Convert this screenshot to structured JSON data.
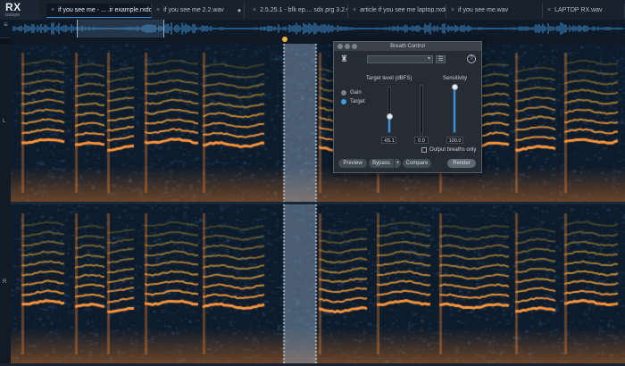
{
  "app": {
    "logo": "RX",
    "logo_sub": "izotope"
  },
  "tabs": [
    {
      "label": "if you see me - ... .ir example.rxdoc",
      "active": true,
      "indicator": ""
    },
    {
      "label": "if you see me 2.2.wav",
      "active": false,
      "indicator": "◆"
    },
    {
      "label": "2.5.25.1 - bfk ep.... sdx prg 3.2.wav",
      "active": false,
      "indicator": ""
    },
    {
      "label": "article if you see me laptop.rxdoc",
      "active": false,
      "indicator": ""
    },
    {
      "label": "if you see me.wav",
      "active": false,
      "indicator": ""
    },
    {
      "label": "LAPTOP RX.wav",
      "active": false,
      "indicator": ""
    }
  ],
  "channels": {
    "left": "L",
    "right": "R"
  },
  "dialog": {
    "title": "Breath Control",
    "target_level_label": "Target level (dBFS)",
    "sensitivity_label": "Sensitivity",
    "gain_label": "Gain",
    "target_label": "Target",
    "mode_selected": "Target",
    "target_value": "-65.1",
    "gain_value": "0.0",
    "sensitivity_value": "100.0",
    "target_slider_level": 0.35,
    "gain_meter_level": 0.0,
    "sensitivity_slider_level": 1.0,
    "output_breaths_only_label": "Output breaths only",
    "preview_label": "Preview",
    "bypass_label": "Bypass",
    "bypass_plus": "+",
    "compare_label": "Compare",
    "render_label": "Render",
    "menu_glyph": "☰",
    "help_glyph": "?",
    "preset_arrow": "▾"
  },
  "colors": {
    "accent": "#2e95e6",
    "playhead": "#f0b43a",
    "spectrogram_hot": "#ffa030",
    "spectrogram_cold": "#102a45"
  }
}
